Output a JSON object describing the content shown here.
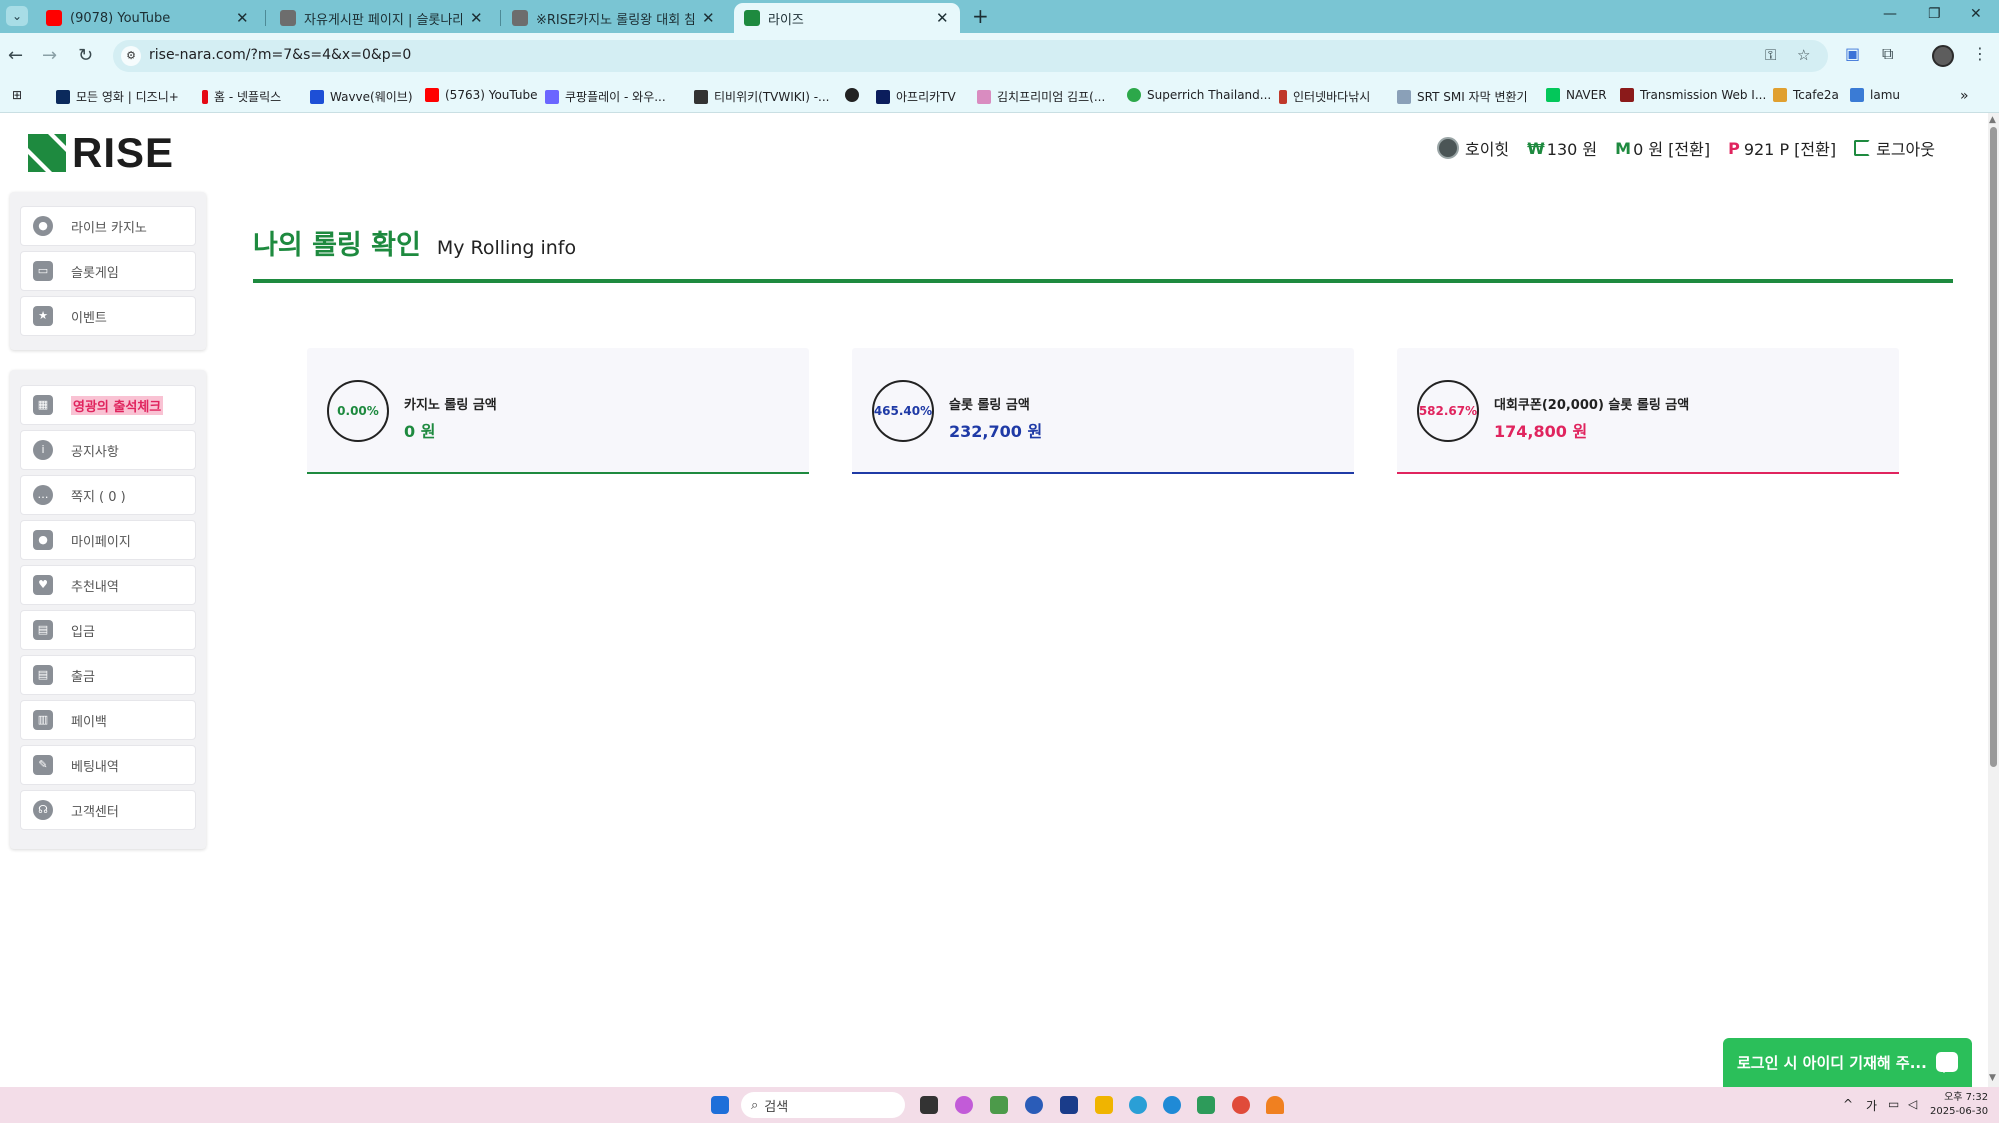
{
  "browser": {
    "tabs": [
      {
        "title": "(9078) YouTube",
        "favicon": "youtube-icon",
        "color": "#ff0000"
      },
      {
        "title": "자유게시판 페이지 | 슬롯나라",
        "favicon": "page-icon",
        "color": "#555555"
      },
      {
        "title": "※RISE카지노 롤링왕 대회 참여",
        "favicon": "page-icon",
        "color": "#555555"
      },
      {
        "title": "라이즈",
        "favicon": "rise-icon",
        "color": "#1e8a3f"
      }
    ],
    "url": "rise-nara.com/?m=7&s=4&x=0&p=0",
    "bookmarks": [
      {
        "label": "모든 영화 | 디즈니+",
        "color": "#0b2a5c"
      },
      {
        "label": "홈 - 넷플릭스",
        "color": "#e50914"
      },
      {
        "label": "Wavve(웨이브)",
        "color": "#1d4fd6"
      },
      {
        "label": "(5763) YouTube",
        "color": "#ff0000"
      },
      {
        "label": "쿠팡플레이 - 와우...",
        "color": "#6b66ff"
      },
      {
        "label": "티비위키(TVWIKI) -...",
        "color": "#333333"
      },
      {
        "label": "",
        "color": "#222222"
      },
      {
        "label": "아프리카TV",
        "color": "#0b1d5c"
      },
      {
        "label": "김치프리미엄 김프(...",
        "color": "#d98cc0"
      },
      {
        "label": "Superrich Thailand...",
        "color": "#2ca84a"
      },
      {
        "label": "인터넷바다낚시",
        "color": "#c0392b"
      },
      {
        "label": "SRT SMI 자막 변환기",
        "color": "#8aa0b8"
      },
      {
        "label": "NAVER",
        "color": "#03c75a"
      },
      {
        "label": "Transmission Web I...",
        "color": "#8b1a1a"
      },
      {
        "label": "Tcafe2a",
        "color": "#e0a030"
      },
      {
        "label": "lamu",
        "color": "#3a7bd5"
      }
    ]
  },
  "site": {
    "logo_text": "RISE",
    "user": {
      "name": "호이힛",
      "won_symbol": "₩",
      "won": "130 원",
      "m_symbol": "M",
      "money": "0 원 [전환]",
      "p_symbol": "P",
      "point": "921 P [전환]",
      "logout": "로그아웃"
    },
    "menu_group1": [
      {
        "label": "라이브 카지노",
        "icon": "casino-chip-icon"
      },
      {
        "label": "슬롯게임",
        "icon": "slot-machine-icon"
      },
      {
        "label": "이벤트",
        "icon": "star-icon"
      }
    ],
    "menu_group2": [
      {
        "label": "영광의 출석체크",
        "icon": "calendar-icon",
        "highlight": true
      },
      {
        "label": "공지사항",
        "icon": "info-icon"
      },
      {
        "label": "쪽지 ( 0 )",
        "icon": "message-icon"
      },
      {
        "label": "마이페이지",
        "icon": "user-icon"
      },
      {
        "label": "추천내역",
        "icon": "heart-icon"
      },
      {
        "label": "입금",
        "icon": "deposit-icon"
      },
      {
        "label": "출금",
        "icon": "withdraw-icon"
      },
      {
        "label": "페이백",
        "icon": "payback-icon"
      },
      {
        "label": "베팅내역",
        "icon": "betting-history-icon"
      },
      {
        "label": "고객센터",
        "icon": "headset-icon"
      }
    ]
  },
  "main": {
    "title_ko": "나의 롤링 확인",
    "title_en": "My Rolling info",
    "cards": [
      {
        "percent": "0.00%",
        "label": "카지노 롤링 금액",
        "value": "0 원",
        "color": "#1e8a3f",
        "line": "#1e8a3f"
      },
      {
        "percent": "465.40%",
        "label": "슬롯 롤링 금액",
        "value": "232,700 원",
        "color": "#1f3aa6",
        "line": "#1f3aa6"
      },
      {
        "percent": "582.67%",
        "label": "대회쿠폰(20,000) 슬롯 롤링 금액",
        "value": "174,800 원",
        "color": "#e0245e",
        "line": "#e0245e"
      }
    ]
  },
  "chat": {
    "label": "로그인 시 아이디 기재해 주..."
  },
  "taskbar": {
    "search_placeholder": "검색",
    "tray_lang": "가",
    "time": "오후 7:32",
    "date": "2025-06-30"
  }
}
